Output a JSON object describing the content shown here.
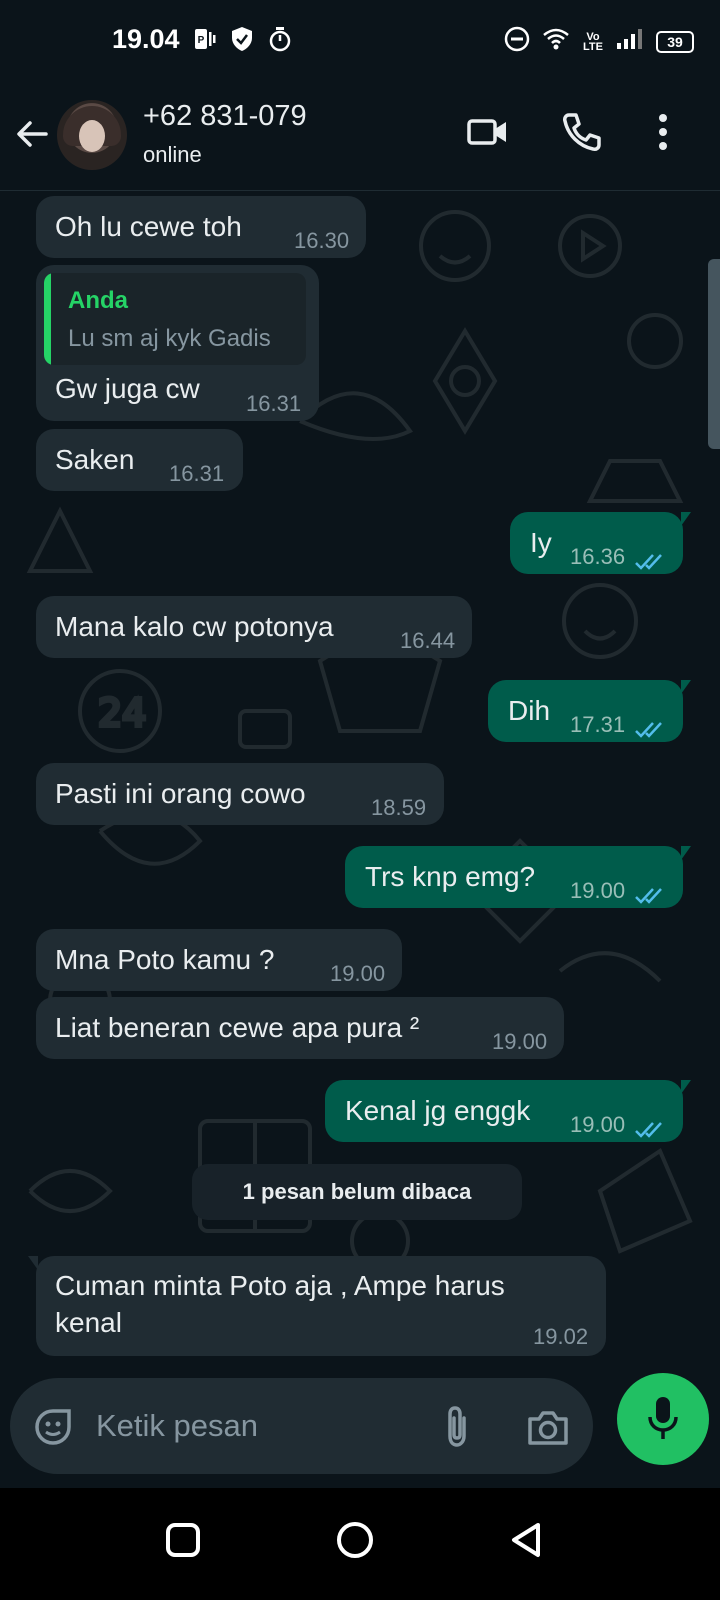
{
  "status_bar": {
    "time": "19.04",
    "battery": "39",
    "network": "Vo LTE",
    "icons": [
      "sim-icon",
      "shield-icon",
      "timer-icon",
      "dnd-icon",
      "wifi-icon",
      "signal-icon",
      "battery-icon"
    ]
  },
  "header": {
    "contact_name": "+62 831-079",
    "status": "online",
    "icons": [
      "back-arrow-icon",
      "video-call-icon",
      "voice-call-icon",
      "more-options-icon"
    ]
  },
  "messages": [
    {
      "dir": "in",
      "text": "Oh lu cewe toh",
      "time": "16.30"
    },
    {
      "dir": "in",
      "quote_name": "Anda",
      "quote_text": "Lu sm aj kyk Gadis",
      "text": "Gw juga cw",
      "time": "16.31"
    },
    {
      "dir": "in",
      "text": "Saken",
      "time": "16.31"
    },
    {
      "dir": "out",
      "text": "Iy",
      "time": "16.36",
      "status": "read"
    },
    {
      "dir": "in",
      "text": "Mana kalo cw potonya",
      "time": "16.44"
    },
    {
      "dir": "out",
      "text": "Dih",
      "time": "17.31",
      "status": "read"
    },
    {
      "dir": "in",
      "text": "Pasti ini orang cowo",
      "time": "18.59"
    },
    {
      "dir": "out",
      "text": "Trs knp emg?",
      "time": "19.00",
      "status": "read"
    },
    {
      "dir": "in",
      "text": "Mna Poto kamu ?",
      "time": "19.00"
    },
    {
      "dir": "in",
      "text": "Liat beneran cewe apa pura ²",
      "time": "19.00"
    },
    {
      "dir": "out",
      "text": "Kenal jg enggk",
      "time": "19.00",
      "status": "read"
    },
    {
      "dir": "in",
      "text_line1": "Cuman minta Poto aja , Ampe harus",
      "text_line2": "kenal",
      "time": "19.02"
    }
  ],
  "unread_divider": "1 pesan belum dibaca",
  "composer": {
    "placeholder": "Ketik pesan",
    "icons": [
      "sticker-icon",
      "attach-icon",
      "camera-icon",
      "mic-icon"
    ]
  },
  "colors": {
    "background": "#0b141a",
    "incoming_bubble": "#202c33",
    "outgoing_bubble": "#005c4b",
    "accent": "#25d366",
    "read_tick": "#53bdeb"
  }
}
